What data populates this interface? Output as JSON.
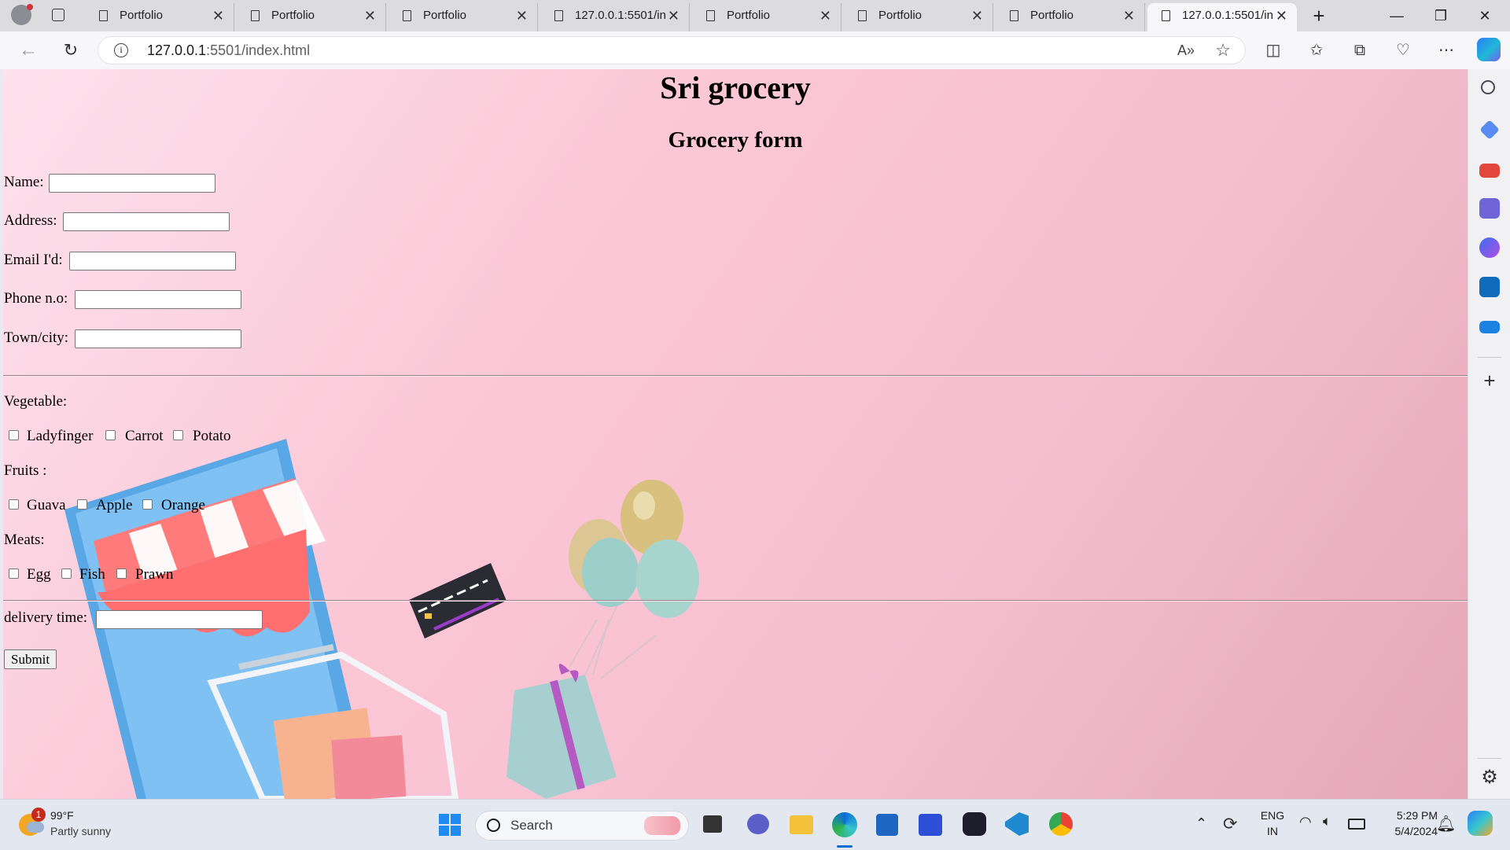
{
  "browser": {
    "tabs": [
      {
        "label": "Portfolio"
      },
      {
        "label": "Portfolio"
      },
      {
        "label": "Portfolio"
      },
      {
        "label": "127.0.0.1:5501/in"
      },
      {
        "label": "Portfolio"
      },
      {
        "label": "Portfolio"
      },
      {
        "label": "Portfolio"
      },
      {
        "label": "127.0.0.1:5501/in"
      }
    ],
    "new_tab_label": "+",
    "url_host": "127.0.0.1",
    "url_path": ":5501/index.html"
  },
  "page": {
    "site_title": "Sri grocery",
    "form_title": "Grocery form",
    "fields": {
      "name_label": "Name:",
      "address_label": "Address:",
      "email_label": "Email I'd:",
      "phone_label": "Phone n.o:",
      "town_label": "Town/city:"
    },
    "vegetable": {
      "label": "Vegetable:",
      "options": [
        "Ladyfinger",
        "Carrot",
        "Potato"
      ]
    },
    "fruits": {
      "label": "Fruits :",
      "options": [
        "Guava",
        "Apple",
        "Orange"
      ]
    },
    "meats": {
      "label": "Meats:",
      "options": [
        "Egg",
        "Fish",
        "Prawn"
      ]
    },
    "delivery_label": "delivery time:",
    "submit_label": "Submit"
  },
  "taskbar": {
    "weather_temp": "99°F",
    "weather_desc": "Partly sunny",
    "weather_badge": "1",
    "search_label": "Search",
    "lang_top": "ENG",
    "lang_bottom": "IN",
    "time": "5:29 PM",
    "date": "5/4/2024"
  },
  "colors": {
    "page_pink": "#fbc6d6",
    "taskbar_bg": "#e3e7ef",
    "edge_blue": "#0a6cd8"
  }
}
